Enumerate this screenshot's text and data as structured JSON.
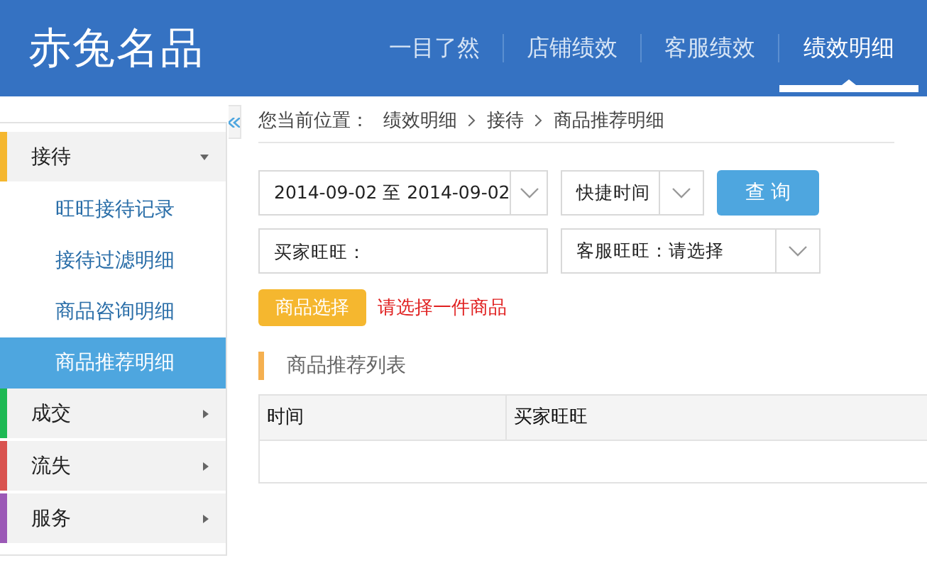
{
  "header": {
    "logo": "赤兔名品",
    "nav": [
      {
        "label": "一目了然",
        "selected": false
      },
      {
        "label": "店铺绩效",
        "selected": false
      },
      {
        "label": "客服绩效",
        "selected": false
      },
      {
        "label": "绩效明细",
        "selected": true
      }
    ]
  },
  "sidebar": {
    "groups": [
      {
        "label": "接待",
        "color": "#f5b72f",
        "expanded": true,
        "children": [
          {
            "label": "旺旺接待记录",
            "selected": false
          },
          {
            "label": "接待过滤明细",
            "selected": false
          },
          {
            "label": "商品咨询明细",
            "selected": false
          },
          {
            "label": "商品推荐明细",
            "selected": true
          }
        ]
      },
      {
        "label": "成交",
        "color": "#1db954",
        "expanded": false
      },
      {
        "label": "流失",
        "color": "#d9534f",
        "expanded": false
      },
      {
        "label": "服务",
        "color": "#9b59b6",
        "expanded": false
      }
    ]
  },
  "breadcrumb": {
    "label": "您当前位置：",
    "items": [
      "绩效明细",
      "接待",
      "商品推荐明细"
    ]
  },
  "filters": {
    "date_range": "2014-09-02 至 2014-09-02",
    "quick_time": "快捷时间",
    "query_button": "查 询",
    "buyer_field": {
      "placeholder": "买家旺旺："
    },
    "service_select": "客服旺旺：请选择",
    "product_button": "商品选择",
    "warning": "请选择一件商品"
  },
  "section": {
    "title": "商品推荐列表"
  },
  "table": {
    "columns": [
      "时间",
      "买家旺旺"
    ]
  }
}
